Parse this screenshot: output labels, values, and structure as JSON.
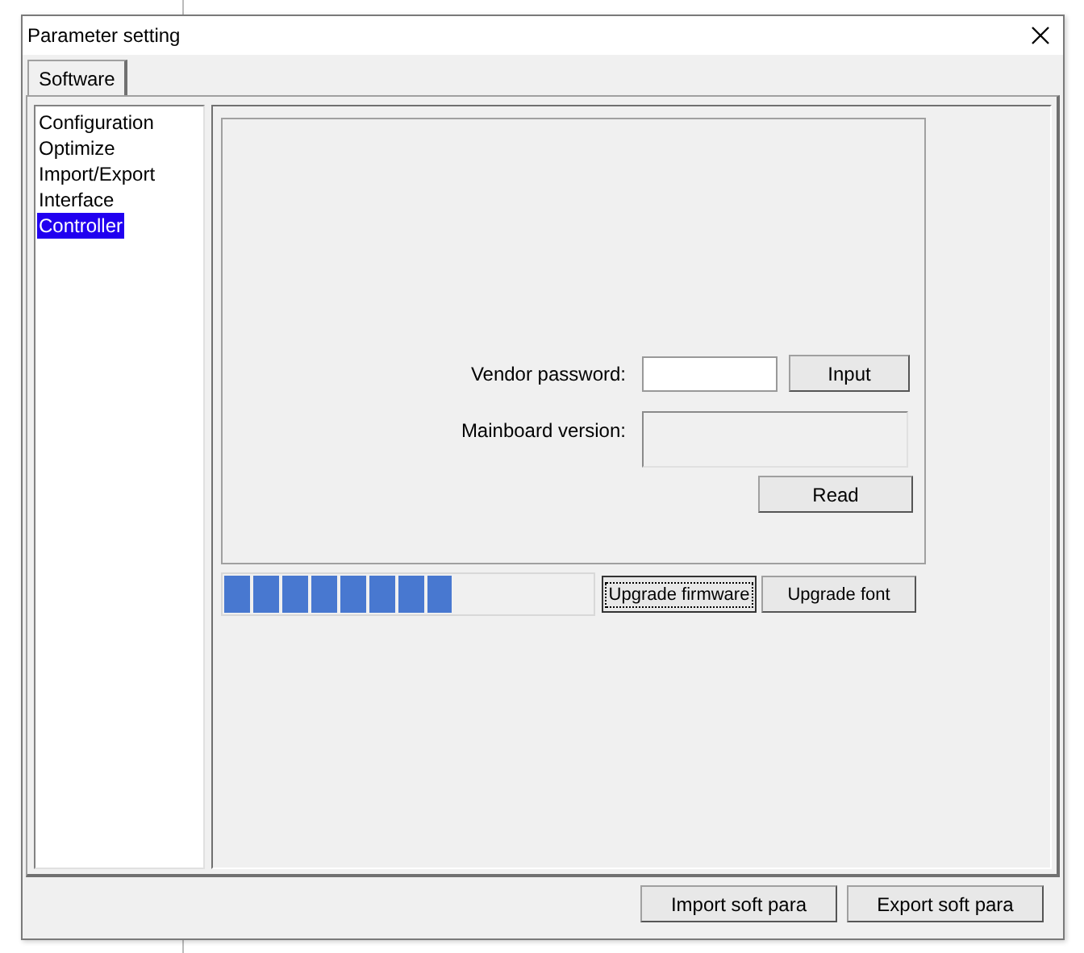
{
  "window": {
    "title": "Parameter setting"
  },
  "tabs": [
    {
      "label": "Software",
      "selected": true
    }
  ],
  "sidebar": {
    "items": [
      {
        "label": "Configuration",
        "selected": false
      },
      {
        "label": "Optimize",
        "selected": false
      },
      {
        "label": "Import/Export",
        "selected": false
      },
      {
        "label": "Interface",
        "selected": false
      },
      {
        "label": "Controller",
        "selected": true
      }
    ]
  },
  "controller": {
    "vendor_password": {
      "label": "Vendor password:",
      "button": "Input"
    },
    "mainboard_version": {
      "label": "Mainboard version:",
      "button": "Read"
    },
    "progress": {
      "level": 0.62
    },
    "buttons": [
      {
        "label": "Upgrade firmware",
        "focused": true
      },
      {
        "label": "Upgrade font",
        "focused": false
      }
    ]
  },
  "footer_buttons": [
    "Import soft para",
    "Export soft para"
  ]
}
